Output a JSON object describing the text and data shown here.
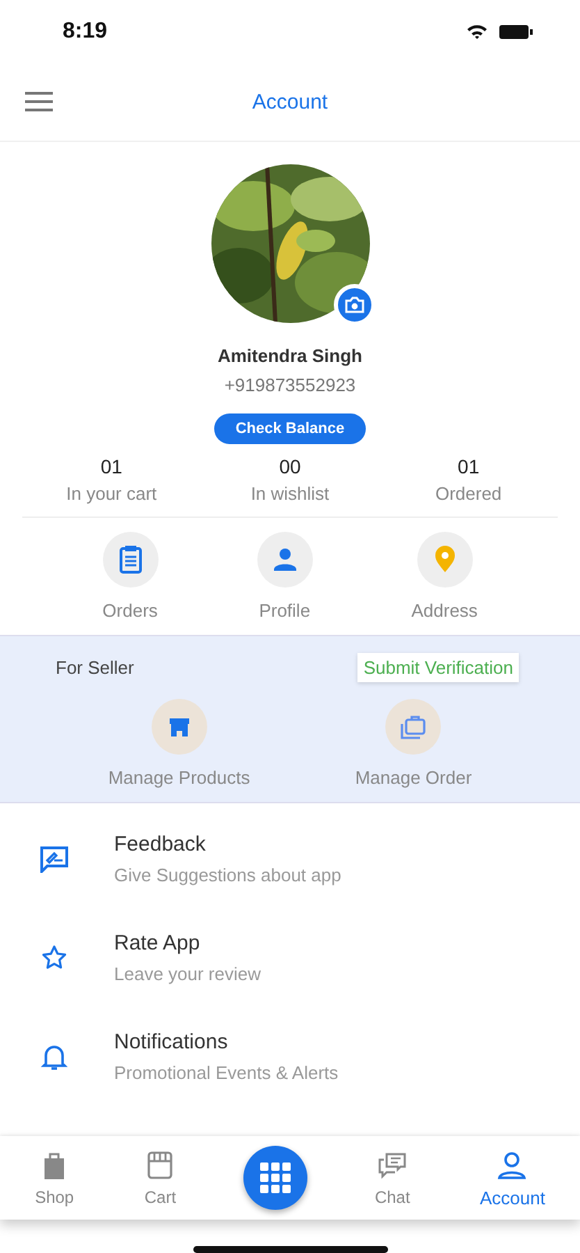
{
  "status_bar": {
    "time": "8:19"
  },
  "header": {
    "title": "Account"
  },
  "profile": {
    "name": "Amitendra Singh",
    "phone": "+919873552923",
    "balance_button": "Check Balance"
  },
  "stats": [
    {
      "value": "01",
      "label": "In your cart"
    },
    {
      "value": "00",
      "label": "In wishlist"
    },
    {
      "value": "01",
      "label": "Ordered"
    }
  ],
  "quick_links": [
    {
      "kind": "orders",
      "label": "Orders"
    },
    {
      "kind": "profile",
      "label": "Profile"
    },
    {
      "kind": "address",
      "label": "Address"
    }
  ],
  "seller": {
    "title": "For Seller",
    "verify_button": "Submit Verification",
    "actions": [
      {
        "kind": "store",
        "label": "Manage Products"
      },
      {
        "kind": "briefcase",
        "label": "Manage Order"
      }
    ]
  },
  "menu": [
    {
      "kind": "feedback",
      "title": "Feedback",
      "subtitle": "Give Suggestions about app"
    },
    {
      "kind": "star",
      "title": "Rate App",
      "subtitle": "Leave your review"
    },
    {
      "kind": "bell",
      "title": "Notifications",
      "subtitle": "Promotional Events & Alerts"
    }
  ],
  "tab_bar": [
    {
      "kind": "bag",
      "label": "Shop",
      "selected": false
    },
    {
      "kind": "store",
      "label": "Cart",
      "selected": false
    },
    {
      "kind": "grid",
      "selected": false
    },
    {
      "kind": "chat",
      "label": "Chat",
      "selected": false
    },
    {
      "kind": "person",
      "label": "Account",
      "selected": true
    }
  ]
}
